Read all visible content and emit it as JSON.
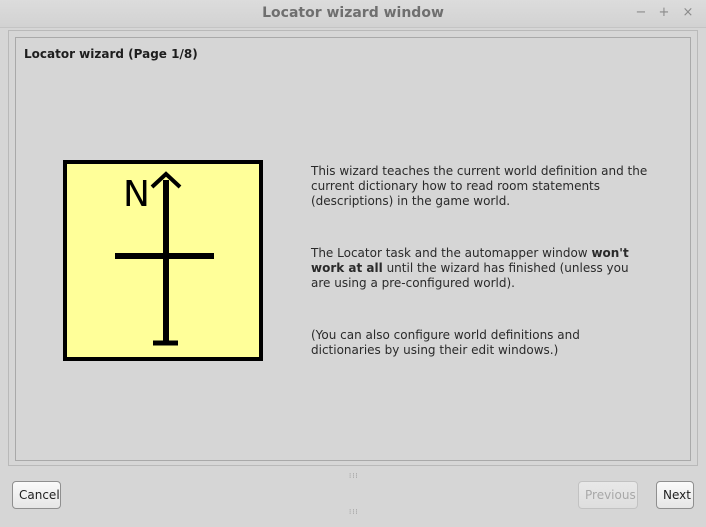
{
  "window": {
    "title": "Locator wizard window",
    "controls": {
      "minimize": "−",
      "maximize": "+",
      "close": "×"
    }
  },
  "wizard": {
    "heading": "Locator wizard (Page 1/8)",
    "compass_label": "N",
    "compass_colors": {
      "fill": "#ffff99",
      "stroke": "#000000"
    },
    "paragraph1": "This wizard teaches the current world definition and the current dictionary how to read room statements (descriptions) in the game world.",
    "paragraph2": {
      "before": "The Locator task and the automapper window ",
      "bold": "won't work at all",
      "after": " until the wizard has finished (unless you are using a pre-configured world)."
    },
    "paragraph3": "(You can also configure world definitions and dictionaries by using their edit windows.)"
  },
  "buttons": {
    "cancel": "Cancel",
    "previous": "Previous",
    "next": "Next",
    "previous_enabled": false
  },
  "grip": "⁞⁞⁞"
}
